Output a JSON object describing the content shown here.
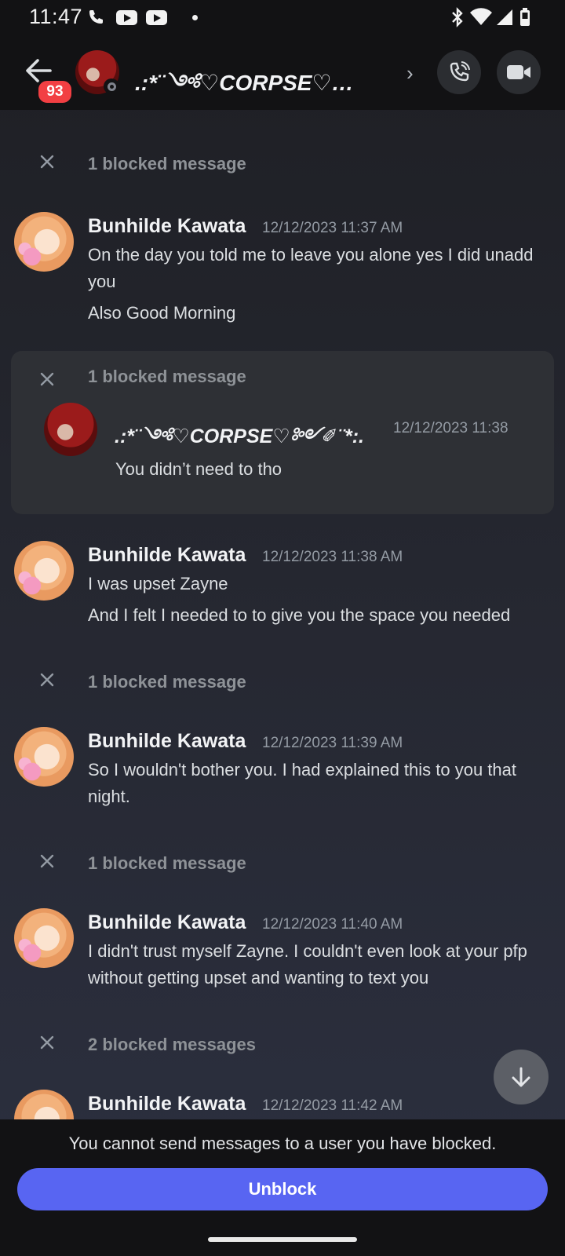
{
  "status_bar": {
    "time": "11:47",
    "icons_left": [
      "phone-icon",
      "youtube-icon",
      "youtube-icon",
      "notification-dot"
    ],
    "icons_right": [
      "bluetooth-icon",
      "wifi-icon",
      "cell-signal-icon",
      "battery-icon"
    ]
  },
  "header": {
    "badge_count": "93",
    "title": ".:*¨༺♡CORPSE♡…",
    "chevron": "›",
    "avatar_text": "CORPSE",
    "presence": "offline"
  },
  "blocked_rows": [
    {
      "label": "1 blocked message"
    },
    {
      "label": "1 blocked message"
    },
    {
      "label": "1 blocked message"
    },
    {
      "label": "1 blocked message"
    },
    {
      "label": "2 blocked messages"
    }
  ],
  "messages": [
    {
      "author": "Bunhilde Kawata",
      "timestamp": "12/12/2023 11:37 AM",
      "lines": [
        "On the day you told me to leave you alone yes I did unadd",
        "you",
        "Also Good Morning"
      ]
    },
    {
      "author": "Bunhilde Kawata",
      "timestamp": "12/12/2023 11:38 AM",
      "lines": [
        "I was upset Zayne",
        "And I felt I needed to to give you the space you needed"
      ]
    },
    {
      "author": "Bunhilde Kawata",
      "timestamp": "12/12/2023 11:39 AM",
      "lines": [
        "So I wouldn't bother you. I had explained this to you that",
        "night."
      ]
    },
    {
      "author": "Bunhilde Kawata",
      "timestamp": "12/12/2023 11:40 AM",
      "lines": [
        "I didn't trust myself Zayne. I couldn't even look at your pfp",
        "without getting upset and wanting to text you"
      ]
    },
    {
      "author": "Bunhilde Kawata",
      "timestamp": "12/12/2023 11:42 AM",
      "lines": []
    }
  ],
  "revealed_blocked": {
    "label": "1 blocked message",
    "author": ".:*¨༺♡CORPSE♡༻✐¨*:.",
    "timestamp": "12/12/2023 11:38",
    "text": "You didn’t need to tho"
  },
  "footer": {
    "notice": "You cannot send messages to a user you have blocked.",
    "unblock_label": "Unblock"
  },
  "colors": {
    "accent": "#5865f2",
    "badge": "#f23f43",
    "header_bg": "#121214"
  }
}
